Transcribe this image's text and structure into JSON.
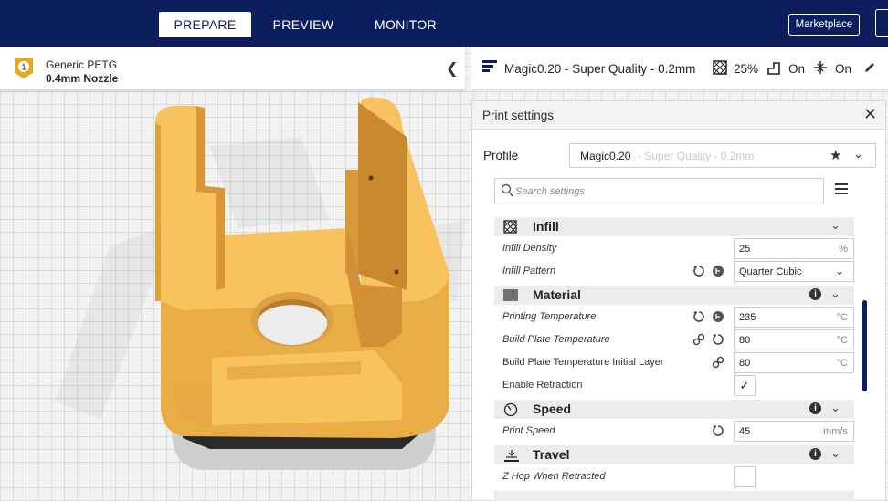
{
  "header": {
    "tabs": [
      {
        "label": "PREPARE",
        "active": true
      },
      {
        "label": "PREVIEW",
        "active": false
      },
      {
        "label": "MONITOR",
        "active": false
      }
    ],
    "marketplace_label": "Marketplace"
  },
  "material": {
    "badge_number": "1",
    "name": "Generic PETG",
    "nozzle": "0.4mm Nozzle",
    "badge_color": "#e8a91a"
  },
  "profile_bar": {
    "profile_name": "Magic0.20 - Super Quality - 0.2mm",
    "infill": "25%",
    "support": "On",
    "adhesion": "On"
  },
  "settings": {
    "title": "Print settings",
    "profile_label": "Profile",
    "profile_main": "Magic0.20",
    "profile_sub": "- Super Quality - 0.2mm",
    "search_placeholder": "Search settings",
    "categories": {
      "infill": {
        "label": "Infill",
        "icon": "infill-icon"
      },
      "material": {
        "label": "Material",
        "icon": "material-icon"
      },
      "speed": {
        "label": "Speed",
        "icon": "speed-icon"
      },
      "travel": {
        "label": "Travel",
        "icon": "travel-icon"
      }
    },
    "rows": {
      "infill_density": {
        "label": "Infill Density",
        "value": "25",
        "unit": "%"
      },
      "infill_pattern": {
        "label": "Infill Pattern",
        "value": "Quarter Cubic"
      },
      "printing_temperature": {
        "label": "Printing Temperature",
        "value": "235",
        "unit": "°C"
      },
      "build_plate_temperature": {
        "label": "Build Plate Temperature",
        "value": "80",
        "unit": "°C"
      },
      "build_plate_temperature_initial": {
        "label": "Build Plate Temperature Initial Layer",
        "value": "80",
        "unit": "°C"
      },
      "enable_retraction": {
        "label": "Enable Retraction",
        "checked": true,
        "mark": "✓"
      },
      "print_speed": {
        "label": "Print Speed",
        "value": "45",
        "unit": "mm/s"
      },
      "z_hop": {
        "label": "Z Hop When Retracted",
        "checked": false
      }
    }
  },
  "colors": {
    "header_bg": "#0c1e5e",
    "model_yellow": "#f8c35e",
    "accent": "#0c1e5e"
  }
}
